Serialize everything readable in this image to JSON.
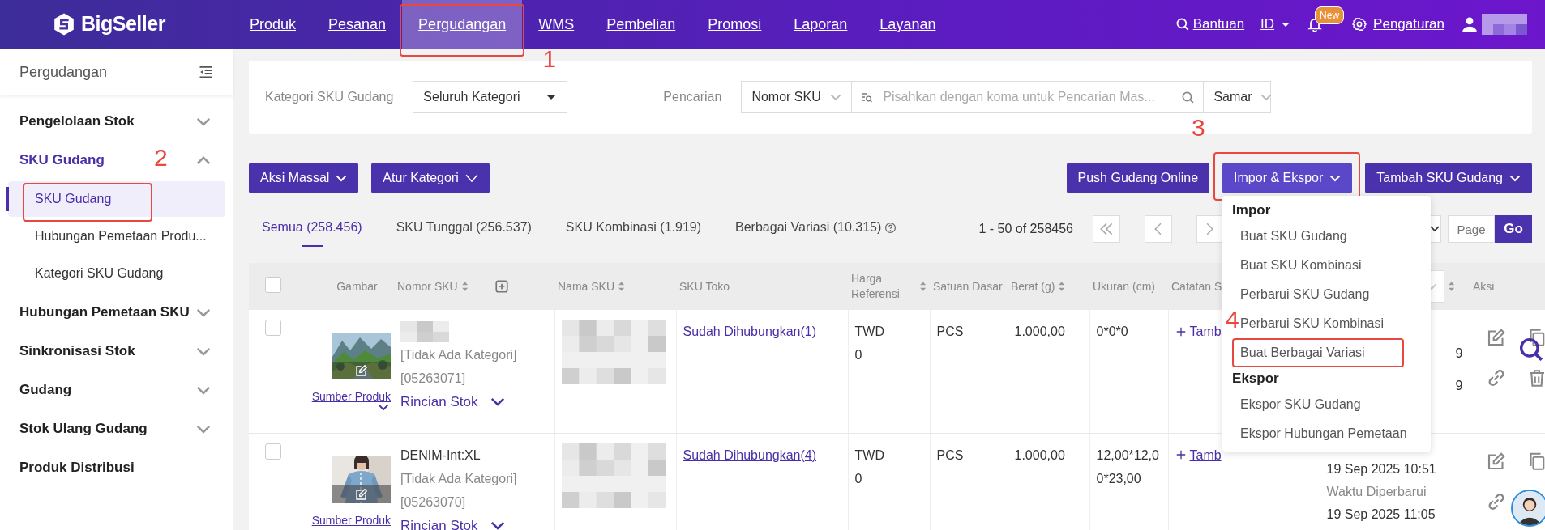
{
  "brand": {
    "name": "BigSeller"
  },
  "nav": [
    {
      "label": "Produk",
      "selected": false
    },
    {
      "label": "Pesanan",
      "selected": false
    },
    {
      "label": "Pergudangan",
      "selected": true,
      "callout": "1"
    },
    {
      "label": "WMS",
      "selected": false
    },
    {
      "label": "Pembelian",
      "selected": false
    },
    {
      "label": "Promosi",
      "selected": false
    },
    {
      "label": "Laporan",
      "selected": false
    },
    {
      "label": "Layanan",
      "selected": false
    }
  ],
  "toolbar": {
    "help": "Bantuan",
    "language": "ID",
    "notification_badge": "New",
    "settings": "Pengaturan"
  },
  "sidebar": {
    "title": "Pergudangan",
    "items": [
      {
        "label": "Pengelolaan Stok",
        "kind": "group",
        "selected": false,
        "expanded": false
      },
      {
        "label": "SKU Gudang",
        "kind": "group",
        "selected": true,
        "expanded": true,
        "children": [
          {
            "label": "SKU Gudang",
            "selected": true,
            "callout": "2"
          },
          {
            "label": "Hubungan Pemetaan Produ...",
            "selected": false
          },
          {
            "label": "Kategori SKU Gudang",
            "selected": false
          }
        ]
      },
      {
        "label": "Hubungan Pemetaan SKU",
        "kind": "group",
        "selected": false,
        "expanded": false
      },
      {
        "label": "Sinkronisasi Stok",
        "kind": "group",
        "selected": false,
        "expanded": false
      },
      {
        "label": "Gudang",
        "kind": "group",
        "selected": false,
        "expanded": false
      },
      {
        "label": "Stok Ulang Gudang",
        "kind": "group",
        "selected": false,
        "expanded": false
      },
      {
        "label": "Produk Distribusi",
        "kind": "link",
        "selected": false
      }
    ]
  },
  "filters": {
    "category_label": "Kategori SKU Gudang",
    "category_value": "Seluruh Kategori",
    "search_label": "Pencarian",
    "search_field": "Nomor SKU",
    "placeholder": "Pisahkan dengan koma untuk Pencarian Mas...",
    "search_mode": "Samar"
  },
  "actions_left": [
    {
      "label": "Aksi Massal",
      "kind": "small-chevron"
    },
    {
      "label": "Atur Kategori",
      "kind": "wide-chevron"
    }
  ],
  "actions_right": [
    {
      "label": "Push Gudang Online",
      "kind": "button"
    },
    {
      "label": "Impor & Ekspor",
      "kind": "menu",
      "expanded": true,
      "callout": "3"
    },
    {
      "label": "Tambah SKU Gudang",
      "kind": "menu",
      "expanded": false
    }
  ],
  "menu": {
    "sections": [
      {
        "title": "Impor",
        "items": [
          {
            "label": "Buat SKU Gudang"
          },
          {
            "label": "Buat SKU Kombinasi"
          },
          {
            "label": "Perbarui SKU Gudang"
          },
          {
            "label": "Perbarui SKU Kombinasi"
          },
          {
            "label": "Buat Berbagai Variasi",
            "callout": "4"
          }
        ]
      },
      {
        "title": "Ekspor",
        "items": [
          {
            "label": "Ekspor SKU Gudang"
          },
          {
            "label": "Ekspor Hubungan Pemetaan"
          }
        ]
      }
    ]
  },
  "tabs": [
    {
      "label": "Semua (258.456)",
      "selected": true
    },
    {
      "label": "SKU Tunggal (256.537)",
      "selected": false
    },
    {
      "label": "SKU Kombinasi (1.919)",
      "selected": false
    },
    {
      "label": "Berbagai Variasi (10.315)",
      "selected": false,
      "help": true
    }
  ],
  "pagination": {
    "range": "1 - 50 of 258456",
    "page_placeholder": "Page",
    "go": "Go"
  },
  "table": {
    "select_all": {
      "checked": false
    },
    "columns": [
      {
        "kind": "text",
        "label": "Gambar"
      },
      {
        "kind": "text",
        "label": "Nomor SKU",
        "sortable": true,
        "addable": true
      },
      {
        "kind": "text",
        "label": "Nama SKU",
        "sortable": true
      },
      {
        "kind": "text",
        "label": "SKU Toko"
      },
      {
        "kind": "text",
        "label": "Harga Referensi",
        "sortable": true
      },
      {
        "kind": "text",
        "label": "Satuan Dasar"
      },
      {
        "kind": "text",
        "label": "Berat (g)",
        "sortable": true
      },
      {
        "kind": "text",
        "label": "Ukuran (cm)"
      },
      {
        "kind": "text",
        "label": "Catatan S"
      },
      {
        "kind": "select",
        "sortable": true
      },
      {
        "kind": "text",
        "label": "Aksi"
      }
    ],
    "rows": [
      {
        "checked": false,
        "image": {
          "kind": "picture"
        },
        "image_link": "Sumber Produk",
        "sku_redacted": true,
        "category": "[Tidak Ada Kategori]",
        "code": "[05263071]",
        "stock_link": "Rincian Stok",
        "name_redacted": true,
        "store_sku": "Sudah Dihubungkan(1)",
        "currency": "TWD",
        "price": "0",
        "unit": "PCS",
        "weight": "1.000,00",
        "size": "0*0*0",
        "note_link": "Tamb",
        "times": [
          {
            "text": "9",
            "kind": "value"
          },
          {
            "text": "9",
            "kind": "value"
          }
        ],
        "actions": [
          {
            "kind": "edit"
          },
          {
            "kind": "copy"
          },
          {
            "kind": "link"
          },
          {
            "kind": "delete"
          }
        ]
      },
      {
        "checked": false,
        "image": {
          "kind": "picture"
        },
        "image_link": "Sumber Produk",
        "sku": "DENIM-Int:XL",
        "category": "[Tidak Ada Kategori]",
        "code": "[05263070]",
        "stock_link": "Rincian Stok",
        "name_redacted": true,
        "store_sku": "Sudah Dihubungkan(4)",
        "currency": "TWD",
        "price": "0",
        "unit": "PCS",
        "weight": "1.000,00",
        "size": "12,00*12,00*23,00",
        "note_link": "Tamb",
        "times": [
          {
            "text": "19 Sep 2025 10:51",
            "kind": "value"
          },
          {
            "text": "Waktu Diperbarui",
            "kind": "label"
          },
          {
            "text": "19 Sep 2025 11:05",
            "kind": "value"
          }
        ],
        "actions": [
          {
            "kind": "edit"
          },
          {
            "kind": "copy"
          },
          {
            "kind": "link"
          }
        ]
      }
    ]
  }
}
